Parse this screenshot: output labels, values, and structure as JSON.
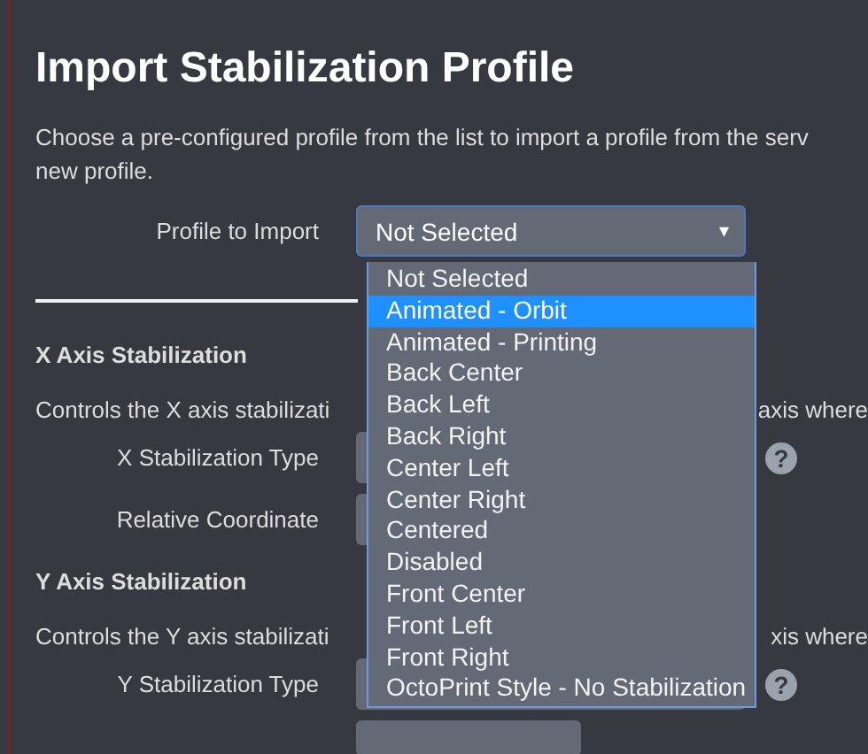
{
  "heading": "Import Stabilization Profile",
  "description_lines": [
    "Choose a pre-configured profile from the list to import a profile from the serv",
    "new profile."
  ],
  "profile_field": {
    "label": "Profile to Import",
    "value": "Not Selected",
    "caret": "▾",
    "expanded": true
  },
  "dropdown_options": [
    {
      "label": "Not Selected",
      "selected": false
    },
    {
      "label": "Animated - Orbit",
      "selected": true
    },
    {
      "label": "Animated - Printing",
      "selected": false
    },
    {
      "label": "Back Center",
      "selected": false
    },
    {
      "label": "Back Left",
      "selected": false
    },
    {
      "label": "Back Right",
      "selected": false
    },
    {
      "label": "Center Left",
      "selected": false
    },
    {
      "label": "Center Right",
      "selected": false
    },
    {
      "label": "Centered",
      "selected": false
    },
    {
      "label": "Disabled",
      "selected": false
    },
    {
      "label": "Front Center",
      "selected": false
    },
    {
      "label": "Front Left",
      "selected": false
    },
    {
      "label": "Front Right",
      "selected": false
    },
    {
      "label": "OctoPrint Style - No Stabilization",
      "selected": false
    }
  ],
  "sections": [
    {
      "title": "X Axis Stabilization",
      "description": "Controls the X axis stabilizati",
      "description_tail": "axis where",
      "fields": [
        {
          "label": "X Stabilization Type",
          "help": "?"
        },
        {
          "label": "Relative Coordinate"
        }
      ]
    },
    {
      "title": "Y Axis Stabilization",
      "description": "Controls the Y axis stabilizati",
      "description_tail": "xis where",
      "fields": [
        {
          "label": "Y Stabilization Type",
          "help": "?"
        }
      ]
    }
  ]
}
